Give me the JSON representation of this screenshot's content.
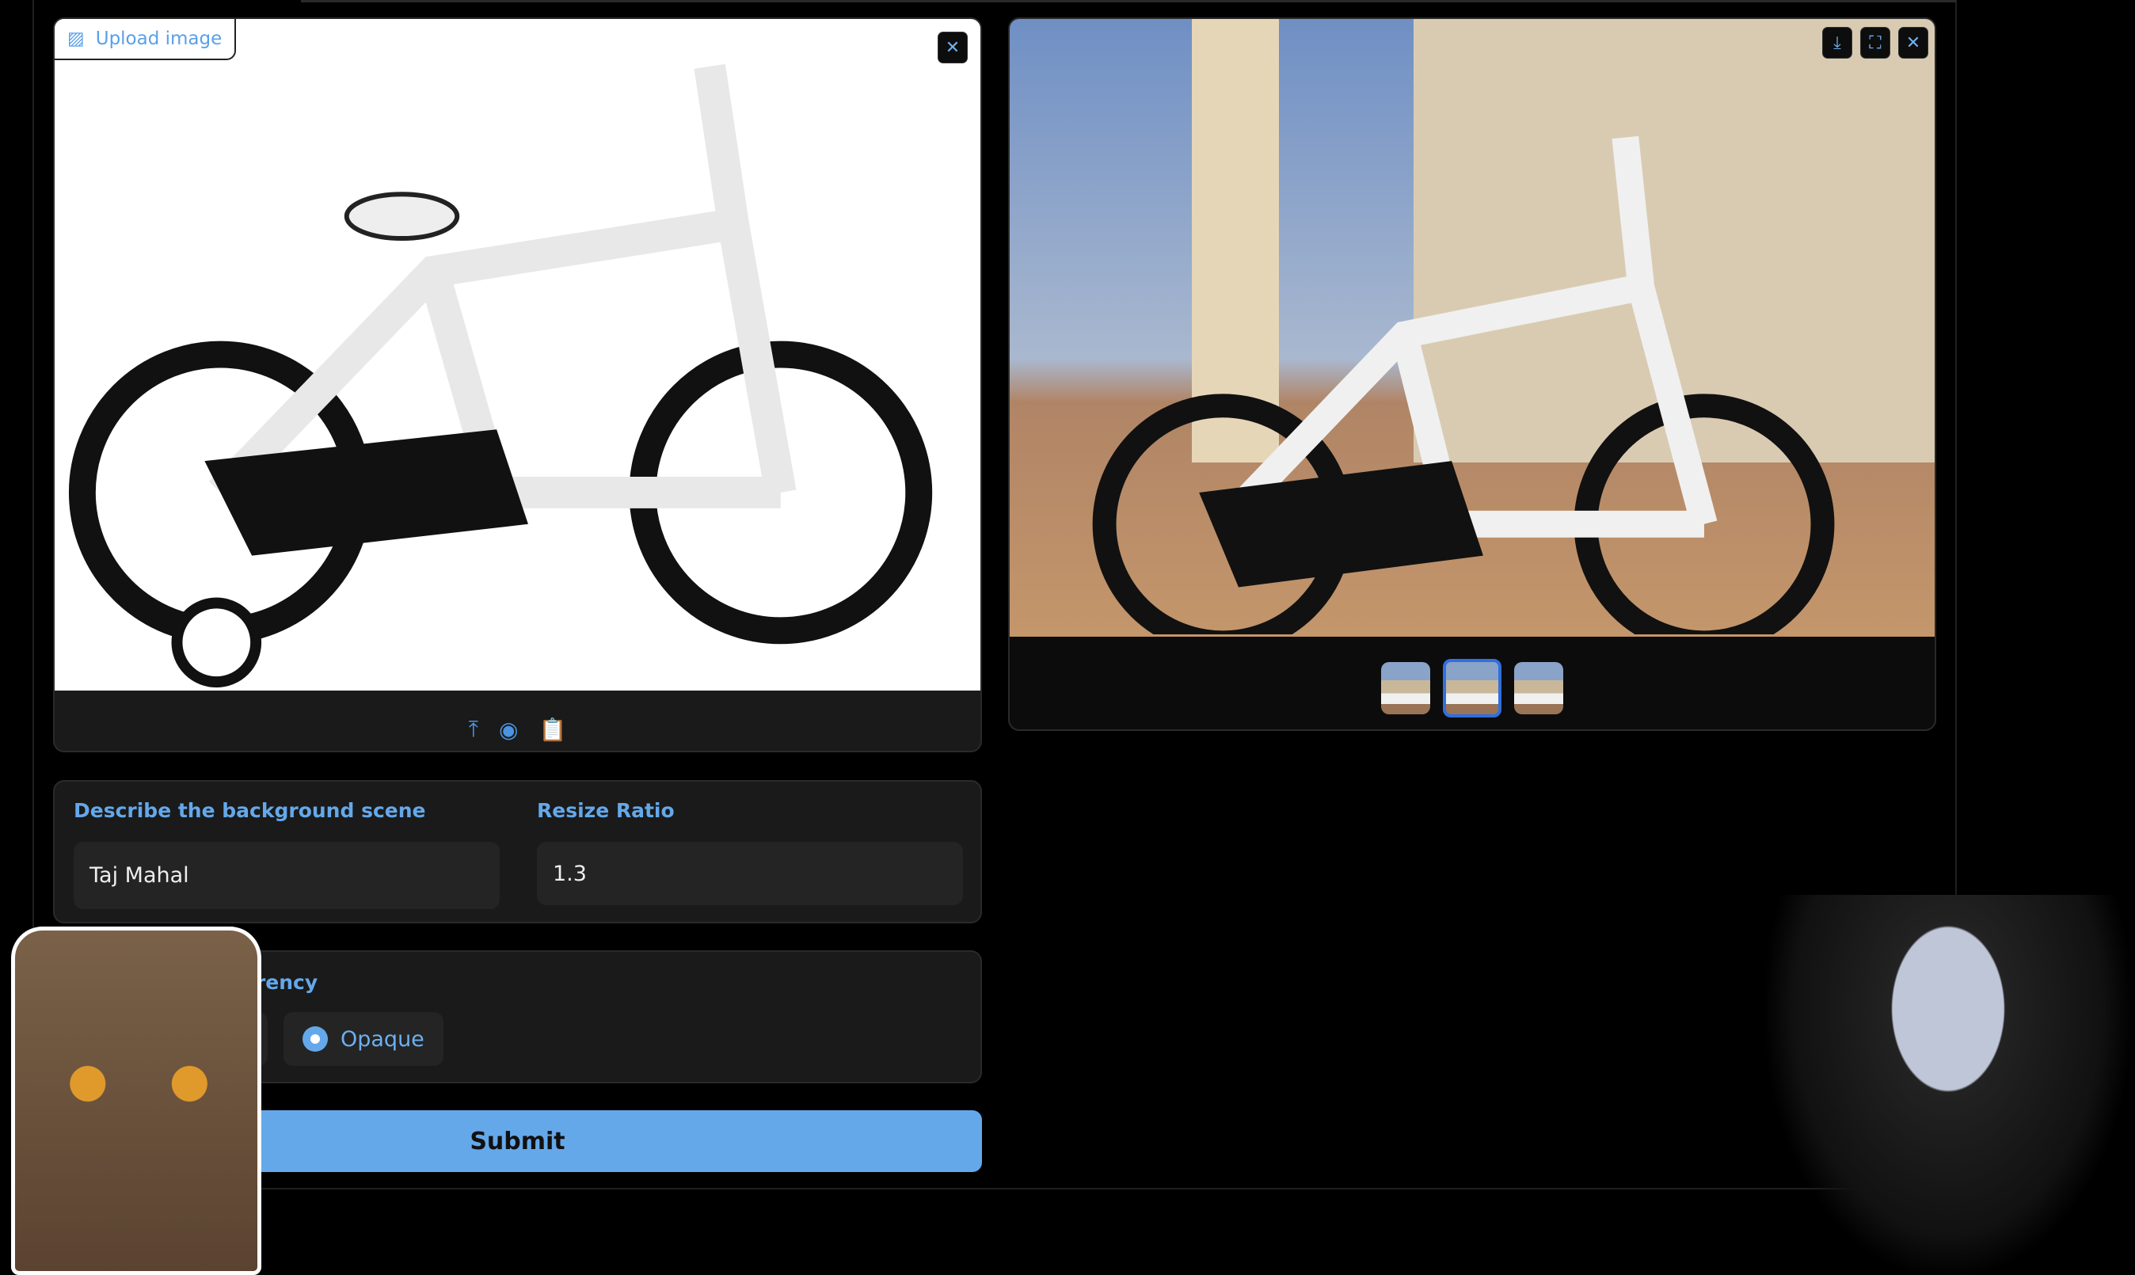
{
  "input_image": {
    "upload_label": "Upload image",
    "close_icon": "close-icon",
    "toolbar_icons": [
      "upload-icon",
      "webcam-icon",
      "clipboard-image-icon"
    ]
  },
  "output_gallery": {
    "icons": [
      "download-icon",
      "fullscreen-icon",
      "close-icon"
    ],
    "thumbnail_count": 3,
    "selected_thumbnail": 2
  },
  "form": {
    "background_label": "Describe the background scene",
    "background_value": "Taj Mahal",
    "resize_label": "Resize Ratio",
    "resize_value": "1.3",
    "transparency_label": "Product Transparency",
    "transparency_selected": "Opaque"
  },
  "submit_label": "Submit",
  "colors": {
    "accent": "#64a8ea",
    "panel": "#1a1a1a",
    "input": "#242424"
  }
}
